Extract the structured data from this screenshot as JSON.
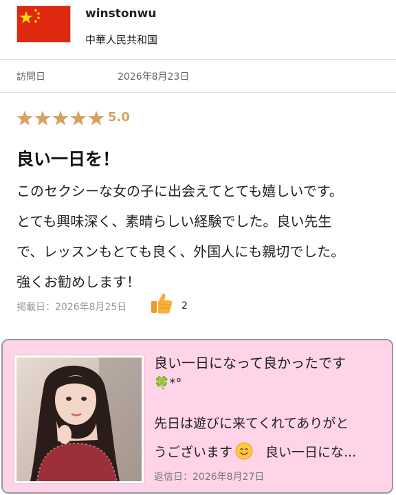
{
  "reviewer": {
    "username": "winstonwu",
    "country": "中華人民共和国",
    "flag_icon": "china-flag-icon",
    "visit_label": "訪問日",
    "visit_date": "2026年8月23日"
  },
  "review": {
    "rating": 5,
    "rating_text": "5.0",
    "star_color": "#d6a264",
    "title": "良い一日を！",
    "body_lines": [
      "このセクシーな女の子に出会えてとても嬉しいです。",
      "とても興味深く、素晴らしい経験でした。良い先生",
      "で、レッスンもとても良く、外国人にも親切でした。",
      "強くお勧めします！"
    ],
    "posted": "掲載日：2026年8月25日",
    "like_icon": "thumbs-up-icon",
    "likes": "2"
  },
  "reply": {
    "background": "#ffd3e8",
    "title": "良い一日になって良かったです",
    "title_emoji": "🍀*°",
    "text_line1": "先日は遊びに来てくれてありがと",
    "text_line2_a": "うございます",
    "smile_icon": "smiling-face-icon",
    "text_line2_b": "良い一日にな...",
    "date": "返信日：2026年8月27日"
  }
}
